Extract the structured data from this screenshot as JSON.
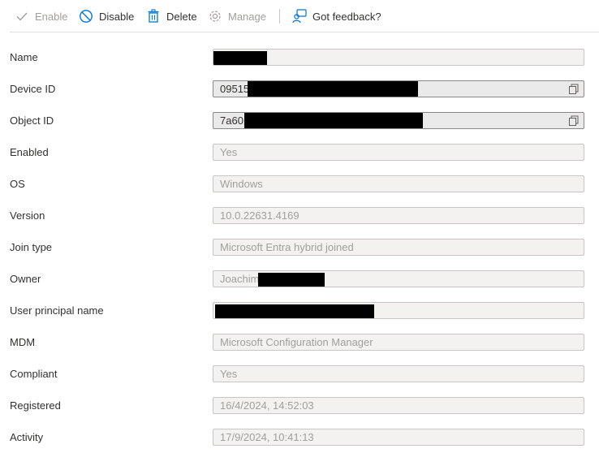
{
  "toolbar": {
    "enable_label": "Enable",
    "disable_label": "Disable",
    "delete_label": "Delete",
    "manage_label": "Manage",
    "feedback_label": "Got feedback?"
  },
  "fields": {
    "name": {
      "label": "Name",
      "value": ""
    },
    "device_id": {
      "label": "Device ID",
      "value": "09515"
    },
    "object_id": {
      "label": "Object ID",
      "value": "7a601"
    },
    "enabled": {
      "label": "Enabled",
      "value": "Yes"
    },
    "os": {
      "label": "OS",
      "value": "Windows"
    },
    "version": {
      "label": "Version",
      "value": "10.0.22631.4169"
    },
    "join_type": {
      "label": "Join type",
      "value": "Microsoft Entra hybrid joined"
    },
    "owner": {
      "label": "Owner",
      "value": "Joachim"
    },
    "upn": {
      "label": "User principal name",
      "value": ""
    },
    "mdm": {
      "label": "MDM",
      "value": "Microsoft Configuration Manager"
    },
    "compliant": {
      "label": "Compliant",
      "value": "Yes"
    },
    "registered": {
      "label": "Registered",
      "value": "16/4/2024, 14:52:03"
    },
    "activity": {
      "label": "Activity",
      "value": "17/9/2024, 10:41:13"
    }
  },
  "colors": {
    "accent": "#0078d4",
    "text": "#323130",
    "disabled_text": "#a19f9d",
    "field_bg": "#f3f2f1",
    "field_border": "#c8c6c4"
  },
  "icons": {
    "enable": "checkmark-icon",
    "disable": "block-icon",
    "delete": "trash-icon",
    "manage": "gear-icon",
    "feedback": "feedback-person-icon",
    "copy": "copy-icon"
  }
}
